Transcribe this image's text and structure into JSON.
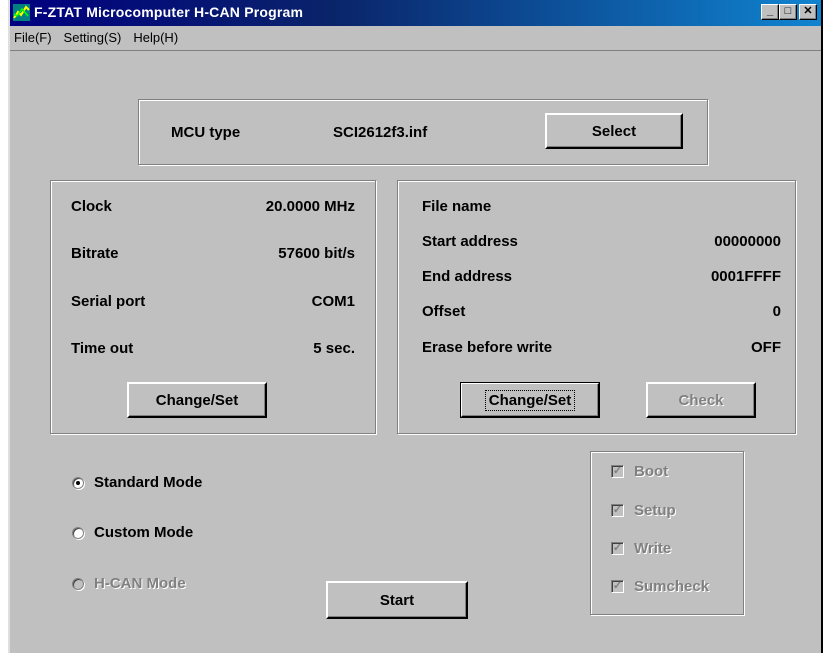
{
  "window": {
    "title": "F-ZTAT Microcomputer H-CAN Program",
    "controls": {
      "minimize": "_",
      "maximize": "□",
      "close": "✕"
    }
  },
  "menu": [
    {
      "label": "File(F)"
    },
    {
      "label": "Setting(S)"
    },
    {
      "label": "Help(H)"
    }
  ],
  "mcu": {
    "label": "MCU type",
    "value": "SCI2612f3.inf",
    "select_button": "Select"
  },
  "comm": {
    "rows": [
      {
        "label": "Clock",
        "value": "20.0000 MHz"
      },
      {
        "label": "Bitrate",
        "value": "57600 bit/s"
      },
      {
        "label": "Serial port",
        "value": "COM1"
      },
      {
        "label": "Time out",
        "value": "5 sec."
      }
    ],
    "change_button": "Change/Set"
  },
  "file": {
    "rows": [
      {
        "label": "File name",
        "value": ""
      },
      {
        "label": "Start address",
        "value": "00000000"
      },
      {
        "label": "End address",
        "value": "0001FFFF"
      },
      {
        "label": "Offset",
        "value": "0"
      },
      {
        "label": "Erase before write",
        "value": "OFF"
      }
    ],
    "change_button": "Change/Set",
    "check_button": "Check"
  },
  "modes": [
    {
      "label": "Standard Mode",
      "checked": true,
      "enabled": true
    },
    {
      "label": "Custom Mode",
      "checked": false,
      "enabled": true
    },
    {
      "label": "H-CAN Mode",
      "checked": false,
      "enabled": false
    }
  ],
  "steps": [
    {
      "label": "Boot",
      "checked": true
    },
    {
      "label": "Setup",
      "checked": true
    },
    {
      "label": "Write",
      "checked": true
    },
    {
      "label": "Sumcheck",
      "checked": true
    }
  ],
  "start_button": "Start",
  "colors": {
    "face": "#c0c0c0",
    "title_start": "#000080",
    "title_end": "#1084d0",
    "disabled_text": "#808080"
  }
}
